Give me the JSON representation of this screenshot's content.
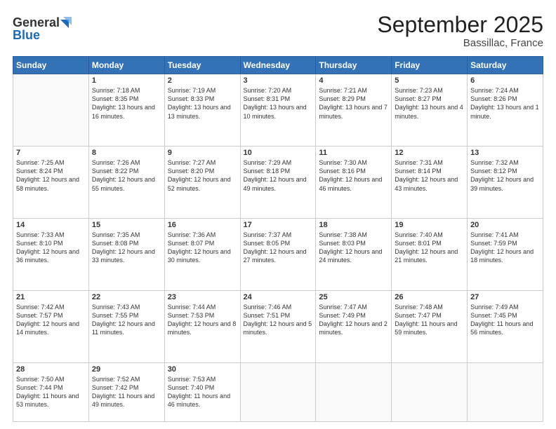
{
  "logo": {
    "line1": "General",
    "line2": "Blue"
  },
  "header": {
    "month": "September 2025",
    "location": "Bassillac, France"
  },
  "weekdays": [
    "Sunday",
    "Monday",
    "Tuesday",
    "Wednesday",
    "Thursday",
    "Friday",
    "Saturday"
  ],
  "weeks": [
    [
      {
        "day": "",
        "sunrise": "",
        "sunset": "",
        "daylight": ""
      },
      {
        "day": "1",
        "sunrise": "Sunrise: 7:18 AM",
        "sunset": "Sunset: 8:35 PM",
        "daylight": "Daylight: 13 hours and 16 minutes."
      },
      {
        "day": "2",
        "sunrise": "Sunrise: 7:19 AM",
        "sunset": "Sunset: 8:33 PM",
        "daylight": "Daylight: 13 hours and 13 minutes."
      },
      {
        "day": "3",
        "sunrise": "Sunrise: 7:20 AM",
        "sunset": "Sunset: 8:31 PM",
        "daylight": "Daylight: 13 hours and 10 minutes."
      },
      {
        "day": "4",
        "sunrise": "Sunrise: 7:21 AM",
        "sunset": "Sunset: 8:29 PM",
        "daylight": "Daylight: 13 hours and 7 minutes."
      },
      {
        "day": "5",
        "sunrise": "Sunrise: 7:23 AM",
        "sunset": "Sunset: 8:27 PM",
        "daylight": "Daylight: 13 hours and 4 minutes."
      },
      {
        "day": "6",
        "sunrise": "Sunrise: 7:24 AM",
        "sunset": "Sunset: 8:26 PM",
        "daylight": "Daylight: 13 hours and 1 minute."
      }
    ],
    [
      {
        "day": "7",
        "sunrise": "Sunrise: 7:25 AM",
        "sunset": "Sunset: 8:24 PM",
        "daylight": "Daylight: 12 hours and 58 minutes."
      },
      {
        "day": "8",
        "sunrise": "Sunrise: 7:26 AM",
        "sunset": "Sunset: 8:22 PM",
        "daylight": "Daylight: 12 hours and 55 minutes."
      },
      {
        "day": "9",
        "sunrise": "Sunrise: 7:27 AM",
        "sunset": "Sunset: 8:20 PM",
        "daylight": "Daylight: 12 hours and 52 minutes."
      },
      {
        "day": "10",
        "sunrise": "Sunrise: 7:29 AM",
        "sunset": "Sunset: 8:18 PM",
        "daylight": "Daylight: 12 hours and 49 minutes."
      },
      {
        "day": "11",
        "sunrise": "Sunrise: 7:30 AM",
        "sunset": "Sunset: 8:16 PM",
        "daylight": "Daylight: 12 hours and 46 minutes."
      },
      {
        "day": "12",
        "sunrise": "Sunrise: 7:31 AM",
        "sunset": "Sunset: 8:14 PM",
        "daylight": "Daylight: 12 hours and 43 minutes."
      },
      {
        "day": "13",
        "sunrise": "Sunrise: 7:32 AM",
        "sunset": "Sunset: 8:12 PM",
        "daylight": "Daylight: 12 hours and 39 minutes."
      }
    ],
    [
      {
        "day": "14",
        "sunrise": "Sunrise: 7:33 AM",
        "sunset": "Sunset: 8:10 PM",
        "daylight": "Daylight: 12 hours and 36 minutes."
      },
      {
        "day": "15",
        "sunrise": "Sunrise: 7:35 AM",
        "sunset": "Sunset: 8:08 PM",
        "daylight": "Daylight: 12 hours and 33 minutes."
      },
      {
        "day": "16",
        "sunrise": "Sunrise: 7:36 AM",
        "sunset": "Sunset: 8:07 PM",
        "daylight": "Daylight: 12 hours and 30 minutes."
      },
      {
        "day": "17",
        "sunrise": "Sunrise: 7:37 AM",
        "sunset": "Sunset: 8:05 PM",
        "daylight": "Daylight: 12 hours and 27 minutes."
      },
      {
        "day": "18",
        "sunrise": "Sunrise: 7:38 AM",
        "sunset": "Sunset: 8:03 PM",
        "daylight": "Daylight: 12 hours and 24 minutes."
      },
      {
        "day": "19",
        "sunrise": "Sunrise: 7:40 AM",
        "sunset": "Sunset: 8:01 PM",
        "daylight": "Daylight: 12 hours and 21 minutes."
      },
      {
        "day": "20",
        "sunrise": "Sunrise: 7:41 AM",
        "sunset": "Sunset: 7:59 PM",
        "daylight": "Daylight: 12 hours and 18 minutes."
      }
    ],
    [
      {
        "day": "21",
        "sunrise": "Sunrise: 7:42 AM",
        "sunset": "Sunset: 7:57 PM",
        "daylight": "Daylight: 12 hours and 14 minutes."
      },
      {
        "day": "22",
        "sunrise": "Sunrise: 7:43 AM",
        "sunset": "Sunset: 7:55 PM",
        "daylight": "Daylight: 12 hours and 11 minutes."
      },
      {
        "day": "23",
        "sunrise": "Sunrise: 7:44 AM",
        "sunset": "Sunset: 7:53 PM",
        "daylight": "Daylight: 12 hours and 8 minutes."
      },
      {
        "day": "24",
        "sunrise": "Sunrise: 7:46 AM",
        "sunset": "Sunset: 7:51 PM",
        "daylight": "Daylight: 12 hours and 5 minutes."
      },
      {
        "day": "25",
        "sunrise": "Sunrise: 7:47 AM",
        "sunset": "Sunset: 7:49 PM",
        "daylight": "Daylight: 12 hours and 2 minutes."
      },
      {
        "day": "26",
        "sunrise": "Sunrise: 7:48 AM",
        "sunset": "Sunset: 7:47 PM",
        "daylight": "Daylight: 11 hours and 59 minutes."
      },
      {
        "day": "27",
        "sunrise": "Sunrise: 7:49 AM",
        "sunset": "Sunset: 7:45 PM",
        "daylight": "Daylight: 11 hours and 56 minutes."
      }
    ],
    [
      {
        "day": "28",
        "sunrise": "Sunrise: 7:50 AM",
        "sunset": "Sunset: 7:44 PM",
        "daylight": "Daylight: 11 hours and 53 minutes."
      },
      {
        "day": "29",
        "sunrise": "Sunrise: 7:52 AM",
        "sunset": "Sunset: 7:42 PM",
        "daylight": "Daylight: 11 hours and 49 minutes."
      },
      {
        "day": "30",
        "sunrise": "Sunrise: 7:53 AM",
        "sunset": "Sunset: 7:40 PM",
        "daylight": "Daylight: 11 hours and 46 minutes."
      },
      {
        "day": "",
        "sunrise": "",
        "sunset": "",
        "daylight": ""
      },
      {
        "day": "",
        "sunrise": "",
        "sunset": "",
        "daylight": ""
      },
      {
        "day": "",
        "sunrise": "",
        "sunset": "",
        "daylight": ""
      },
      {
        "day": "",
        "sunrise": "",
        "sunset": "",
        "daylight": ""
      }
    ]
  ]
}
